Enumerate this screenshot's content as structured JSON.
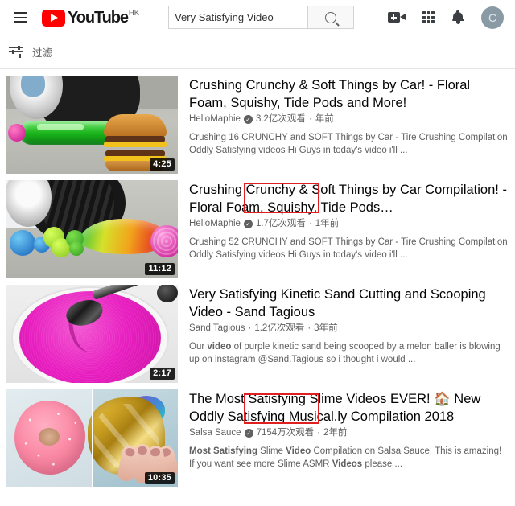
{
  "header": {
    "menu_icon": "hamburger-menu-icon",
    "logo_text": "YouTube",
    "logo_country": "HK",
    "search": {
      "value": "Very Satisfying Video",
      "placeholder": "搜索",
      "button_icon": "search-icon"
    },
    "actions": [
      {
        "name": "create-video-icon",
        "label": "创建"
      },
      {
        "name": "apps-grid-icon",
        "label": "YouTube 应用"
      },
      {
        "name": "notifications-bell-icon",
        "label": "通知"
      }
    ],
    "avatar_letter": "C"
  },
  "filter_bar": {
    "icon": "filter-icon",
    "label": "过滤"
  },
  "results": [
    {
      "title": "Crushing Crunchy & Soft Things by Car! - Floral Foam, Squishy, Tide Pods and More!",
      "channel": "HelloMaphie",
      "verified": true,
      "views": "3.2亿次观看",
      "age": "年前",
      "description": "Crushing 16 CRUNCHY and SOFT Things by Car - Tire Crushing Compilation Oddly Satisfying videos Hi Guys in today's video i'll ...",
      "duration": "4:25",
      "thumbnail": "car-tire-crushing-green-squishy-and-burger",
      "annotated": true
    },
    {
      "title": "Crushing Crunchy & Soft Things by Car Compilation! - Floral Foam, Squishy, Tide Pods…",
      "channel": "HelloMaphie",
      "verified": true,
      "views": "1.7亿次观看",
      "age": "1年前",
      "description": "Crushing 52 CRUNCHY and SOFT Things by Car - Tire Crushing Compilation Oddly Satisfying videos Hi Guys in today's video i'll ...",
      "duration": "11:12",
      "thumbnail": "car-tire-crushing-rainbow-slime-and-balls",
      "annotated": true
    },
    {
      "title": "Very Satisfying Kinetic Sand Cutting and Scooping Video - Sand Tagious",
      "channel": "Sand Tagious",
      "verified": false,
      "views": "1.2亿次观看",
      "age": "3年前",
      "description": "Our video of purple kinetic sand being scooped by a melon baller is blowing up on instagram @Sand.Tagious so i thought i would ...",
      "description_bold": [
        "video"
      ],
      "duration": "2:17",
      "thumbnail": "pink-kinetic-sand-bowl-with-scoop",
      "annotated": false
    },
    {
      "title": "The Most Satisfying Slime Videos EVER! 🏠 New Oddly Satisfying Musical.ly Compilation 2018",
      "channel": "Salsa Sauce",
      "verified": true,
      "views": "7154万次观看",
      "age": "2年前",
      "description": "Most Satisfying Slime Video Compilation on Salsa Sauce! This is amazing! If you want see more Slime ASMR Videos please ...",
      "description_bold": [
        "Most Satisfying",
        "Video",
        "Videos"
      ],
      "duration": "10:35",
      "thumbnail": "pink-donut-slime-and-gold-foil-slime",
      "annotated": false
    }
  ],
  "colors": {
    "brand_red": "#ff0000",
    "annotation_red": "#e02020",
    "meta_gray": "#606060",
    "title_black": "#030303"
  }
}
